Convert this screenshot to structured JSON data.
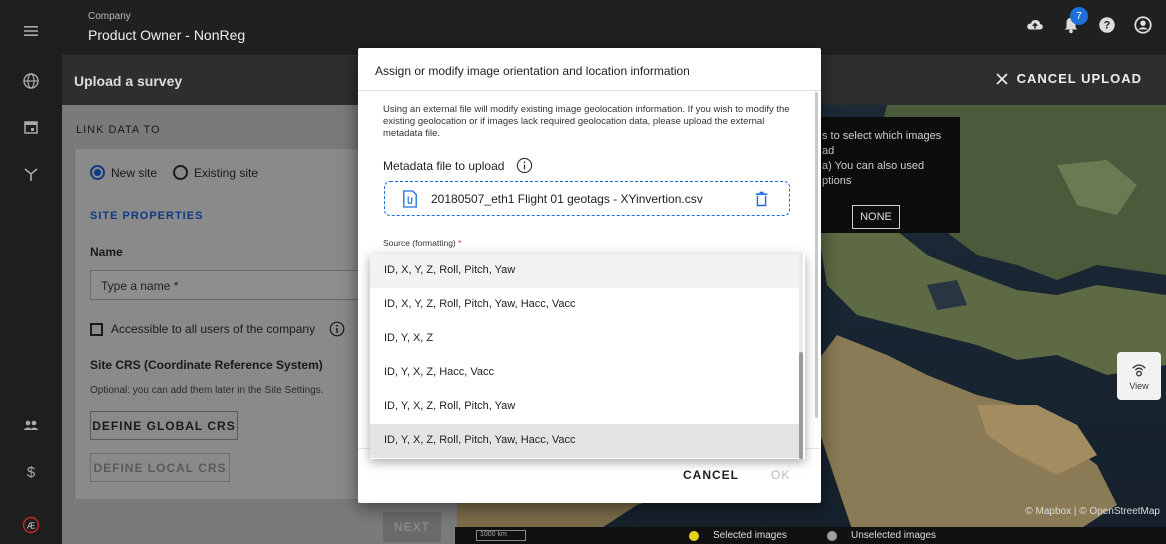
{
  "header": {
    "company_label": "Company",
    "company_name": "Product Owner - NonReg",
    "notification_count": "7"
  },
  "subheader": {
    "title": "Upload a survey",
    "cancel_label": "CANCEL UPLOAD"
  },
  "panel": {
    "link_data_label": "LINK DATA TO",
    "radio_new_site": "New site",
    "radio_existing_site": "Existing site",
    "site_properties": "SITE PROPERTIES",
    "name_label": "Name",
    "name_placeholder": "Type a name *",
    "accessible_label": "Accessible to all users of the company",
    "crs_title": "Site CRS (Coordinate Reference System)",
    "crs_hint": "Optional: you can add them later in the Site Settings.",
    "define_global_crs": "DEFINE GLOBAL CRS",
    "define_local_crs": "DEFINE LOCAL CRS",
    "next_label": "NEXT"
  },
  "map": {
    "hint_line1": "s to select which images",
    "hint_line2": "ad",
    "hint_line3": "a) You can also used",
    "hint_line4": "ptions",
    "none_label": "NONE",
    "view_label": "View",
    "attribution": "© Mapbox | © OpenStreetMap",
    "legend_selected": "Selected images",
    "legend_unselected": "Unselected images",
    "selected_color": "#e5d31a",
    "unselected_color": "#9e9e9e",
    "scalebar_label": "1000 km"
  },
  "modal": {
    "title": "Assign or modify image orientation and location information",
    "description": "Using an external file will modify existing image geolocation information. If you wish to modify the existing geolocation or if images lack required geolocation data, please upload the external metadata file.",
    "metadata_label": "Metadata file to upload",
    "file_name": "20180507_eth1 Flight 01 geotags - XYinvertion.csv",
    "source_label": "Source (formatting)",
    "source_required_mark": "*",
    "cancel_label": "CANCEL",
    "ok_label": "OK",
    "accent_color": "#1e6fd9"
  },
  "dropdown": {
    "options": [
      "ID, X, Y, Z, Roll, Pitch, Yaw",
      "ID, X, Y, Z, Roll, Pitch, Yaw, Hacc, Vacc",
      "ID, Y, X, Z",
      "ID, Y, X, Z, Hacc, Vacc",
      "ID, Y, X, Z, Roll, Pitch, Yaw",
      "ID, Y, X, Z, Roll, Pitch, Yaw, Hacc, Vacc"
    ],
    "selected_index": 5
  }
}
